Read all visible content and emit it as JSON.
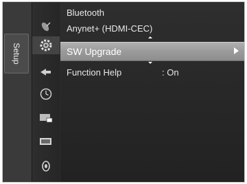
{
  "side_tab": {
    "label": "Setup"
  },
  "icons": [
    "satellite-dish-icon",
    "setup-gear-icon",
    "input-arrow-icon",
    "clock-icon",
    "picture-in-picture-icon",
    "picture-icon",
    "sound-icon"
  ],
  "active_icon": "setup-gear-icon",
  "menu": {
    "items": [
      {
        "label": "Bluetooth",
        "value": ""
      },
      {
        "label": "Anynet+ (HDMI-CEC)",
        "value": ""
      },
      {
        "label": "SW Upgrade",
        "value": "",
        "selected": true
      },
      {
        "label": "Function Help",
        "value": ": On"
      }
    ]
  },
  "colors": {
    "panel": "#2b2b2b",
    "highlight": "#a3a3a3",
    "text": "#e8e8e8"
  }
}
